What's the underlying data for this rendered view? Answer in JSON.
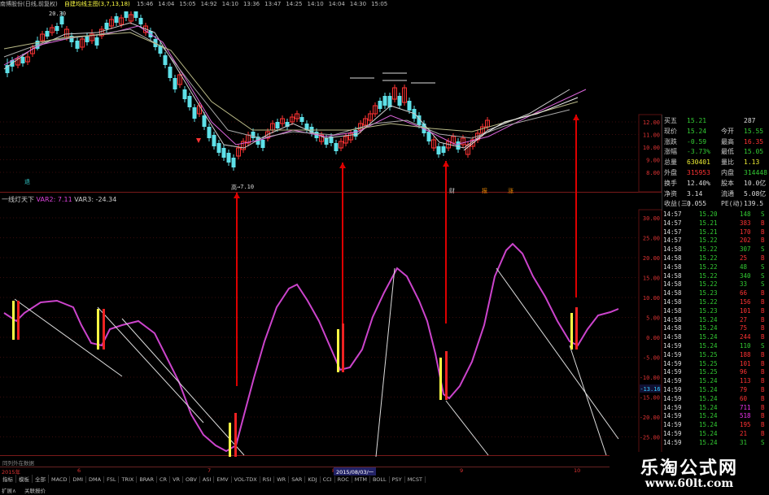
{
  "topbar": {
    "stock": "南博股份(日线,前复权)",
    "indicator": "自建均线主图(3,7,13,18)",
    "times": [
      "15:46",
      "14:04",
      "15:05",
      "14:92",
      "14:10",
      "13:36",
      "13:47",
      "14:25",
      "14:10",
      "14:04",
      "14:30",
      "15:05"
    ],
    "price_tag": "20.30"
  },
  "main_panel": {
    "price_labels": [
      "12.00",
      "11.00",
      "10.00",
      "9.00",
      "8.00"
    ],
    "low_label": "7.10",
    "markers": {
      "left": "退",
      "left2": "↓",
      "mid": "高",
      "right1": "财",
      "right2": "报",
      "right3": "涨"
    }
  },
  "sub_panel": {
    "title": "一线灯天下",
    "var2": "VAR2: 7.11",
    "var3": "VAR3: -24.34",
    "scale_labels": [
      "30.00",
      "25.00",
      "20.00",
      "15.00",
      "10.00",
      "5.00",
      "0.00",
      "-5.00",
      "-10.00",
      "-15.00",
      "-20.00",
      "-25.00"
    ],
    "current_value": "-13.16"
  },
  "quote": {
    "rows": [
      {
        "label": "买五",
        "v1": "15.21",
        "v2": "",
        "v3": "287"
      },
      {
        "label": "现价",
        "v1": "15.24",
        "v2": "今开",
        "v3": "15.55"
      },
      {
        "label": "涨跌",
        "v1": "-0.59",
        "v2": "最高",
        "v3": "16.35"
      },
      {
        "label": "涨幅",
        "v1": "-3.73%",
        "v2": "最低",
        "v3": "15.05"
      },
      {
        "label": "总量",
        "v1": "630401",
        "v2": "量比",
        "v3": "1.13"
      },
      {
        "label": "外盘",
        "v1": "315953",
        "v2": "内盘",
        "v3": "314448"
      },
      {
        "label": "换手",
        "v1": "12.40%",
        "v2": "股本",
        "v3": "10.0亿"
      },
      {
        "label": "净资",
        "v1": "3.14",
        "v2": "流通",
        "v3": "5.08亿"
      },
      {
        "label": "收益(三)",
        "v1": "0.055",
        "v2": "PE(动)",
        "v3": "139.5"
      }
    ]
  },
  "ticks": [
    {
      "t": "14:57",
      "p": "15.20",
      "v": "148",
      "d": "S"
    },
    {
      "t": "14:57",
      "p": "15.21",
      "v": "383",
      "d": "B"
    },
    {
      "t": "14:57",
      "p": "15.21",
      "v": "170",
      "d": "B"
    },
    {
      "t": "14:57",
      "p": "15.22",
      "v": "202",
      "d": "B"
    },
    {
      "t": "14:58",
      "p": "15.22",
      "v": "307",
      "d": "S"
    },
    {
      "t": "14:58",
      "p": "15.22",
      "v": "25",
      "d": "B"
    },
    {
      "t": "14:58",
      "p": "15.22",
      "v": "48",
      "d": "S"
    },
    {
      "t": "14:58",
      "p": "15.22",
      "v": "340",
      "d": "S"
    },
    {
      "t": "14:58",
      "p": "15.22",
      "v": "33",
      "d": "S"
    },
    {
      "t": "14:58",
      "p": "15.23",
      "v": "66",
      "d": "B"
    },
    {
      "t": "14:58",
      "p": "15.22",
      "v": "156",
      "d": "B"
    },
    {
      "t": "14:58",
      "p": "15.23",
      "v": "101",
      "d": "B"
    },
    {
      "t": "14:58",
      "p": "15.24",
      "v": "27",
      "d": "B"
    },
    {
      "t": "14:58",
      "p": "15.24",
      "v": "75",
      "d": "B"
    },
    {
      "t": "14:58",
      "p": "15.24",
      "v": "244",
      "d": "B"
    },
    {
      "t": "14:59",
      "p": "15.24",
      "v": "110",
      "d": "S"
    },
    {
      "t": "14:59",
      "p": "15.25",
      "v": "188",
      "d": "B"
    },
    {
      "t": "14:59",
      "p": "15.25",
      "v": "101",
      "d": "B"
    },
    {
      "t": "14:59",
      "p": "15.25",
      "v": "96",
      "d": "B"
    },
    {
      "t": "14:59",
      "p": "15.24",
      "v": "113",
      "d": "B"
    },
    {
      "t": "14:59",
      "p": "15.24",
      "v": "79",
      "d": "B"
    },
    {
      "t": "14:59",
      "p": "15.24",
      "v": "60",
      "d": "B"
    },
    {
      "t": "14:59",
      "p": "15.24",
      "v": "711",
      "d": "B"
    },
    {
      "t": "14:59",
      "p": "15.24",
      "v": "518",
      "d": "B"
    },
    {
      "t": "14:59",
      "p": "15.24",
      "v": "195",
      "d": "B"
    },
    {
      "t": "14:59",
      "p": "15.24",
      "v": "21",
      "d": "B"
    },
    {
      "t": "14:59",
      "p": "15.24",
      "v": "31",
      "d": "S"
    }
  ],
  "bottom": {
    "dates": [
      "2015年",
      "6",
      "7",
      "8",
      "2015/08/03/一",
      "9",
      "10"
    ],
    "tabs": [
      "指标",
      "模板",
      "全部",
      "MACD",
      "DMI",
      "DMA",
      "FSL",
      "TRIX",
      "BRAR",
      "CR",
      "VR",
      "OBV",
      "ASI",
      "EMV",
      "VOL-TDX",
      "RSI",
      "WR",
      "SAR",
      "KDJ",
      "CCI",
      "ROC",
      "MTM",
      "BOLL",
      "PSY",
      "MCST"
    ],
    "footer": [
      "扩展∧",
      "关联报价"
    ],
    "note": "同列外在数据"
  },
  "logo": {
    "name": "乐淘公式网",
    "url": "www.60lt.com"
  }
}
